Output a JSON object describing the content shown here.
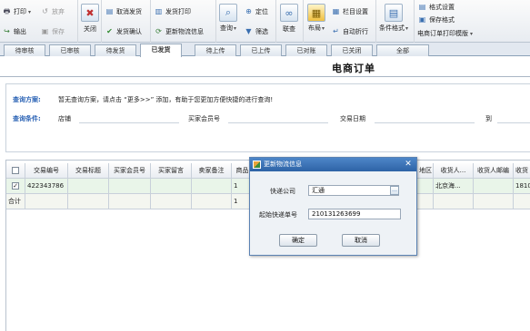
{
  "ribbon": {
    "print_label": "打印",
    "export_label": "输出",
    "abandon_label": "放弃",
    "save_label": "保存",
    "close_label": "关闭",
    "cancel_ship_label": "取消发货",
    "confirm_ship_label": "发货确认",
    "ship_print_label": "发货打印",
    "update_logistics_label": "更新物流信息",
    "query_label": "查询",
    "locate_label": "定位",
    "filter_label": "筛选",
    "link_query_label": "联查",
    "layout_label": "布局",
    "column_settings_label": "栏目设置",
    "auto_wrap_label": "自动折行",
    "conditional_format_label": "条件格式",
    "format_settings_label": "格式设置",
    "save_format_label": "保存格式",
    "print_template_label": "电商订单打印模版"
  },
  "tabs": [
    "待审核",
    "已审核",
    "待发货",
    "已发货",
    "待上传",
    "已上传",
    "已对账",
    "已关闭",
    "全部"
  ],
  "active_tab": "已发货",
  "page_title": "电商订单",
  "query": {
    "scheme_label": "查询方案:",
    "scheme_hint": "暂无查询方案，请点击 “更多>>” 添加，有助于您更加方便快捷的进行查询!",
    "condition_label": "查询条件:",
    "store_label": "店铺",
    "member_label": "买家会员号",
    "date_label": "交易日期",
    "to_label": "到"
  },
  "grid": {
    "headers": [
      "交易编号",
      "交易标题",
      "买家会员号",
      "买家留言",
      "卖家备注",
      "商品",
      "",
      "",
      "",
      "",
      "地区",
      "收货人...",
      "收货人邮编",
      "收货"
    ],
    "row": {
      "checked": "✓",
      "trade_no": "422343786",
      "qty": "1",
      "region": "",
      "receiver": "北京海...",
      "phone": "1810"
    },
    "total_label": "合计",
    "total_qty": "1"
  },
  "dialog": {
    "title": "更新物流信息",
    "courier_label": "快递公司",
    "courier_value": "汇通",
    "tracking_label": "起始快递单号",
    "tracking_value": "210131263699",
    "ok_label": "确定",
    "cancel_label": "取消"
  },
  "colors": {
    "accent_blue": "#2b63b5",
    "dialog_title": "#2e63a6",
    "row_highlight": "#e9f5e9"
  }
}
